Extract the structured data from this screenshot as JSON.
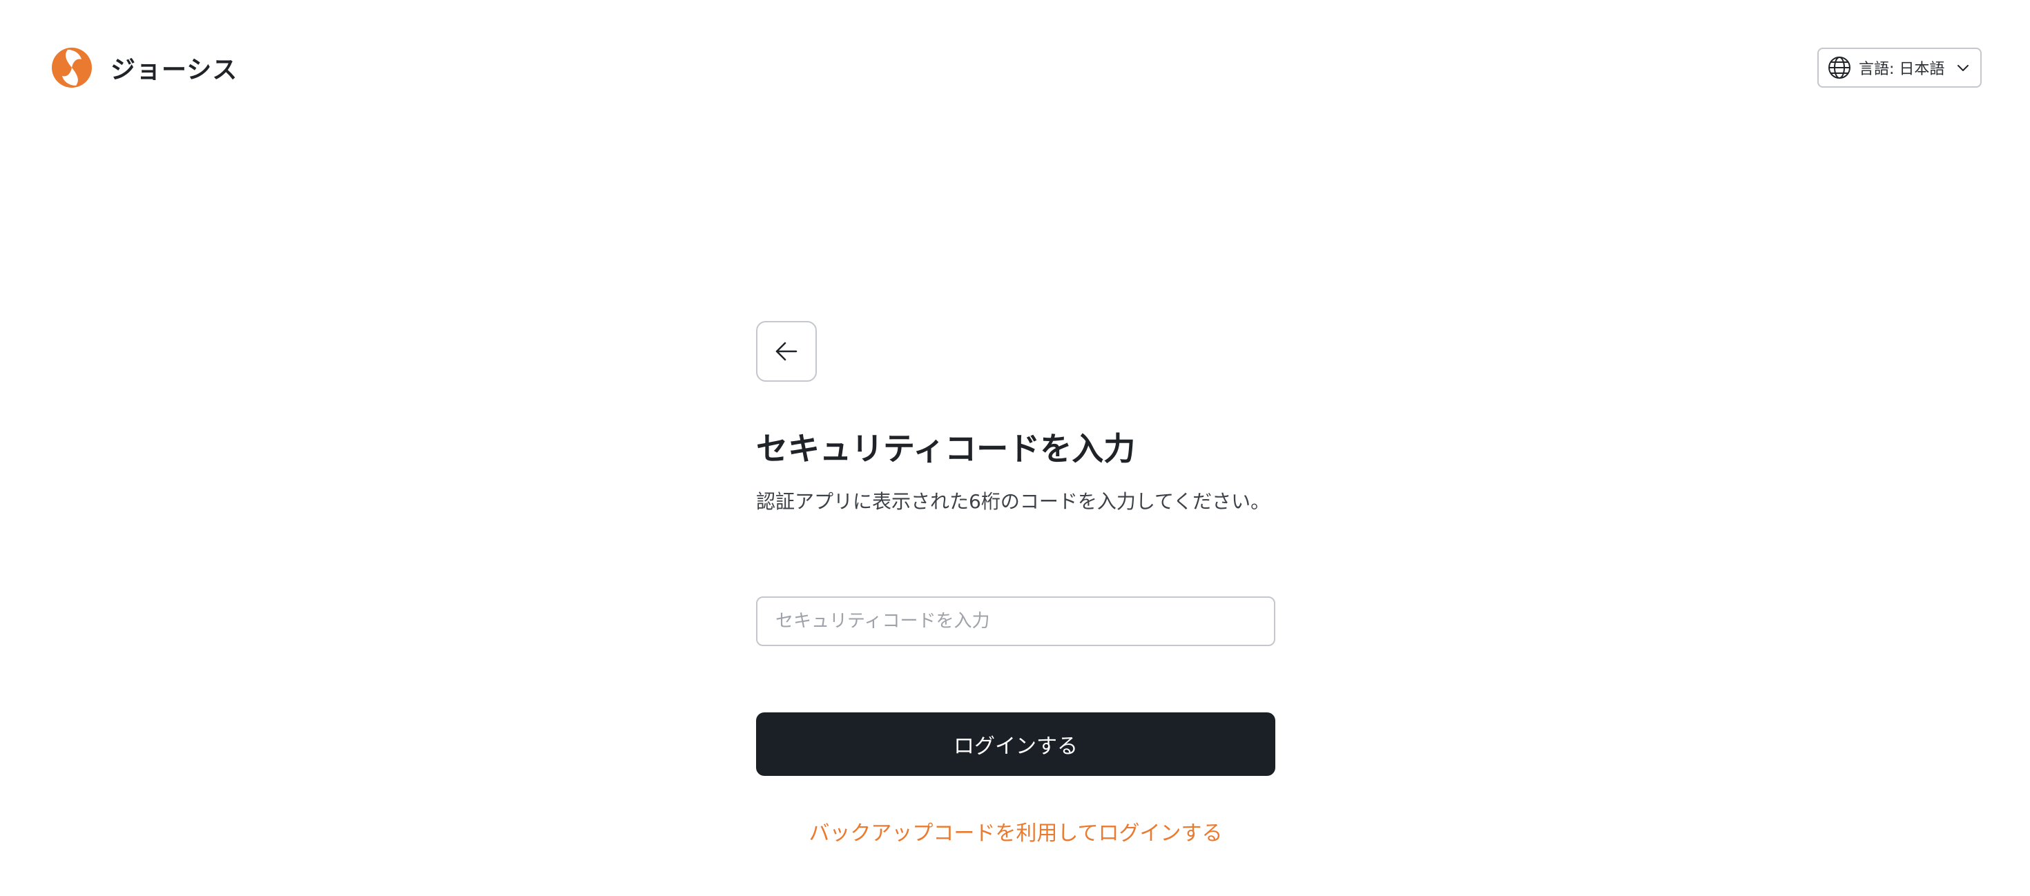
{
  "brand": {
    "name": "ジョーシス",
    "accent_color": "#EA7A2F"
  },
  "language_selector": {
    "label": "言語: 日本語 |",
    "icon": "globe-icon",
    "chevron_icon": "chevron-down-icon"
  },
  "form": {
    "back_icon": "arrow-left-icon",
    "title": "セキュリティコードを入力",
    "description": "認証アプリに表示された6桁のコードを入力してください。",
    "code_input": {
      "value": "",
      "placeholder": "セキュリティコードを入力"
    },
    "submit_label": "ログインする",
    "backup_link_label": "バックアップコードを利用してログインする"
  },
  "colors": {
    "button_bg": "#1B1F26",
    "link": "#EA7A2F",
    "border": "#C4C7CC"
  }
}
